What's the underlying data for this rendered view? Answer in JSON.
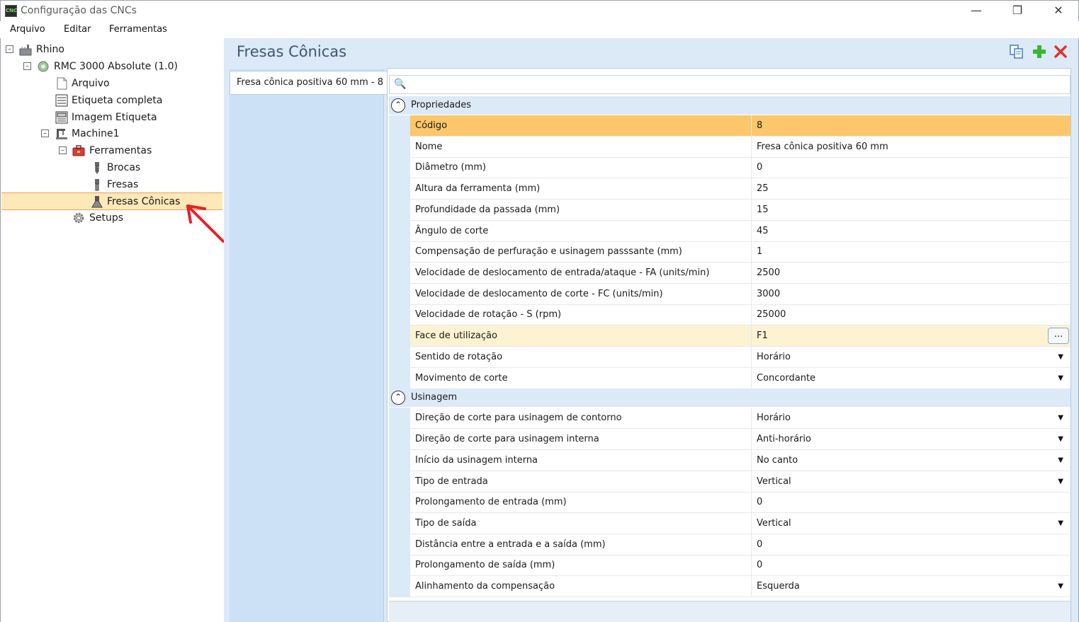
{
  "window": {
    "title": "Configuração das CNCs",
    "app_icon_text": "CNC"
  },
  "menu": [
    {
      "label": "Arquivo"
    },
    {
      "label": "Editar"
    },
    {
      "label": "Ferramentas"
    }
  ],
  "tree": {
    "nodes": [
      {
        "label": "Rhino",
        "icon": "factory-icon"
      },
      {
        "label": "RMC 3000 Absolute (1.0)",
        "icon": "machine-icon"
      },
      {
        "label": "Arquivo",
        "icon": "document-icon"
      },
      {
        "label": "Etiqueta completa",
        "icon": "label-icon"
      },
      {
        "label": "Imagem Etiqueta",
        "icon": "label-image-icon"
      },
      {
        "label": "Machine1",
        "icon": "cnc-machine-icon"
      },
      {
        "label": "Ferramentas",
        "icon": "toolbox-icon"
      },
      {
        "label": "Brocas",
        "icon": "drill-bit-icon"
      },
      {
        "label": "Fresas",
        "icon": "end-mill-icon"
      },
      {
        "label": "Fresas Cônicas",
        "icon": "conical-mill-icon"
      },
      {
        "label": "Setups",
        "icon": "gear-icon"
      }
    ],
    "selected": "Fresas Cônicas"
  },
  "main": {
    "title": "Fresas Cônicas",
    "toolbar": {
      "copy_icon": "copy-icon",
      "add_icon": "add-icon",
      "delete_icon": "delete-icon"
    },
    "list": [
      {
        "label": "Fresa cônica positiva 60 mm - 8"
      }
    ],
    "search": {
      "value": "",
      "icon": "search-icon"
    },
    "categories": [
      {
        "label": "Propriedades",
        "rows": [
          {
            "name": "Código",
            "value": "8",
            "type": "text"
          },
          {
            "name": "Nome",
            "value": "Fresa cônica positiva 60 mm",
            "type": "text"
          },
          {
            "name": "Diâmetro (mm)",
            "value": "0",
            "type": "text"
          },
          {
            "name": "Altura da ferramenta (mm)",
            "value": "25",
            "type": "text"
          },
          {
            "name": "Profundidade da passada (mm)",
            "value": "15",
            "type": "text"
          },
          {
            "name": "Ângulo de corte",
            "value": "45",
            "type": "text"
          },
          {
            "name": "Compensação de perfuração e usinagem passsante (mm)",
            "value": "1",
            "type": "text"
          },
          {
            "name": "Velocidade de deslocamento de entrada/ataque - FA (units/min)",
            "value": "2500",
            "type": "text"
          },
          {
            "name": "Velocidade de deslocamento de corte - FC (units/min)",
            "value": "3000",
            "type": "text"
          },
          {
            "name": "Velocidade de rotação - S (rpm)",
            "value": "25000",
            "type": "text"
          },
          {
            "name": "Face de utilização",
            "value": "F1",
            "type": "ellipsis",
            "button_label": "..."
          },
          {
            "name": "Sentido de rotação",
            "value": "Horário",
            "type": "dropdown"
          },
          {
            "name": "Movimento de corte",
            "value": "Concordante",
            "type": "dropdown"
          }
        ]
      },
      {
        "label": "Usinagem",
        "rows": [
          {
            "name": "Direção de corte para usinagem de contorno",
            "value": "Horário",
            "type": "dropdown"
          },
          {
            "name": "Direção de corte para usinagem interna",
            "value": "Anti-horário",
            "type": "dropdown"
          },
          {
            "name": "Início da usinagem interna",
            "value": "No canto",
            "type": "dropdown"
          },
          {
            "name": "Tipo de entrada",
            "value": "Vertical",
            "type": "dropdown"
          },
          {
            "name": "Prolongamento de entrada (mm)",
            "value": "0",
            "type": "text"
          },
          {
            "name": "Tipo de saída",
            "value": "Vertical",
            "type": "dropdown"
          },
          {
            "name": "Distância entre a entrada e a saída (mm)",
            "value": "0",
            "type": "text"
          },
          {
            "name": "Prolongamento de saída (mm)",
            "value": "0",
            "type": "text"
          },
          {
            "name": "Alinhamento da compensação",
            "value": "Esquerda",
            "type": "dropdown"
          }
        ]
      }
    ]
  },
  "colors": {
    "selection": "#fbc76a",
    "pane_bg": "#dce9f7",
    "annotation_arrow": "#e8202a"
  }
}
